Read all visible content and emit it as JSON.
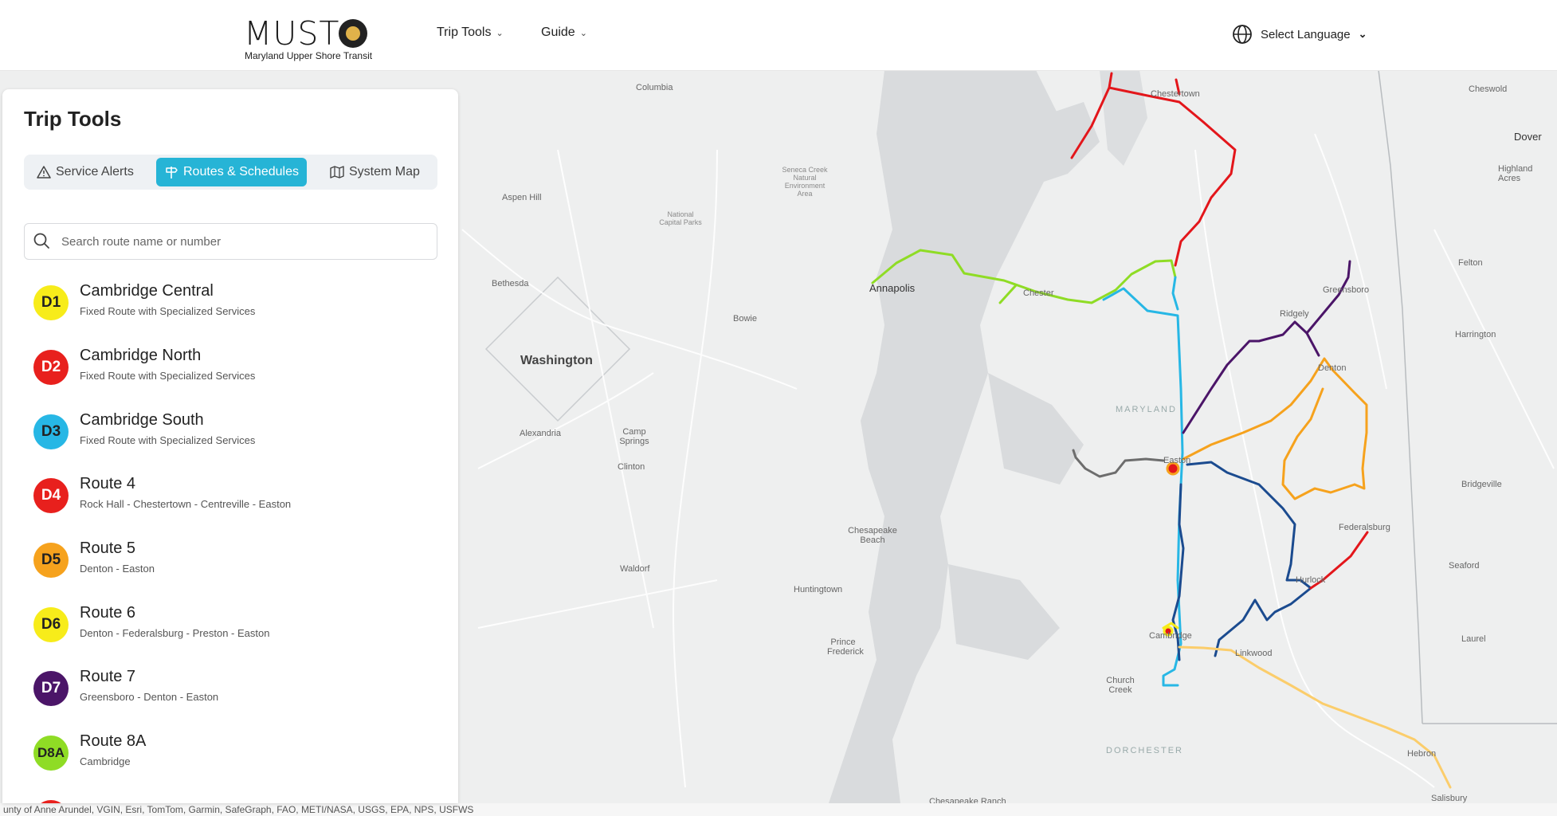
{
  "header": {
    "logo_text": "MUST",
    "logo_subtitle": "Maryland Upper Shore Transit",
    "nav": [
      {
        "label": "Trip Tools"
      },
      {
        "label": "Guide"
      }
    ],
    "language_label": "Select Language"
  },
  "panel": {
    "title": "Trip Tools",
    "tabs": [
      {
        "label": "Service Alerts",
        "icon": "alert-triangle-icon",
        "active": false
      },
      {
        "label": "Routes & Schedules",
        "icon": "signpost-icon",
        "active": true
      },
      {
        "label": "System Map",
        "icon": "map-icon",
        "active": false
      }
    ],
    "search": {
      "placeholder": "Search route name or number",
      "value": ""
    },
    "routes": [
      {
        "code": "D1",
        "name": "Cambridge Central",
        "desc": "Fixed Route with Specialized Services",
        "color": "#f7ec1a",
        "text_color": "#222222"
      },
      {
        "code": "D2",
        "name": "Cambridge North",
        "desc": "Fixed Route with Specialized Services",
        "color": "#e8201d",
        "text_color": "#ffffff"
      },
      {
        "code": "D3",
        "name": "Cambridge South",
        "desc": "Fixed Route with Specialized Services",
        "color": "#27b7e5",
        "text_color": "#222222"
      },
      {
        "code": "D4",
        "name": "Route 4",
        "desc": "Rock Hall - Chestertown - Centreville - Easton",
        "color": "#e8201d",
        "text_color": "#ffffff"
      },
      {
        "code": "D5",
        "name": "Route 5",
        "desc": "Denton - Easton",
        "color": "#f6a21d",
        "text_color": "#222222"
      },
      {
        "code": "D6",
        "name": "Route 6",
        "desc": "Denton - Federalsburg - Preston - Easton",
        "color": "#f7ec1a",
        "text_color": "#222222"
      },
      {
        "code": "D7",
        "name": "Route 7",
        "desc": "Greensboro - Denton - Easton",
        "color": "#4b1568",
        "text_color": "#ffffff"
      },
      {
        "code": "D8A",
        "name": "Route 8A",
        "desc": "Cambridge",
        "color": "#8fdc25",
        "text_color": "#222222"
      }
    ]
  },
  "map": {
    "labels": [
      {
        "text": "Columbia",
        "cls": ""
      },
      {
        "text": "Chestertown",
        "cls": ""
      },
      {
        "text": "Cheswold",
        "cls": ""
      },
      {
        "text": "Dover",
        "cls": "mid"
      },
      {
        "text": "Highland Acres",
        "cls": ""
      },
      {
        "text": "Aspen Hill",
        "cls": ""
      },
      {
        "text": "Seneca Creek Natural Environment Area",
        "cls": ""
      },
      {
        "text": "National Capital Parks",
        "cls": ""
      },
      {
        "text": "Bethesda",
        "cls": ""
      },
      {
        "text": "Annapolis",
        "cls": "mid"
      },
      {
        "text": "Chester",
        "cls": ""
      },
      {
        "text": "Bowie",
        "cls": ""
      },
      {
        "text": "Washington",
        "cls": "big"
      },
      {
        "text": "Ridgely",
        "cls": ""
      },
      {
        "text": "Greensboro",
        "cls": ""
      },
      {
        "text": "Felton",
        "cls": ""
      },
      {
        "text": "Harrington",
        "cls": ""
      },
      {
        "text": "Denton",
        "cls": ""
      },
      {
        "text": "MARYLAND",
        "cls": "region"
      },
      {
        "text": "Alexandria",
        "cls": ""
      },
      {
        "text": "Camp Springs",
        "cls": ""
      },
      {
        "text": "Clinton",
        "cls": ""
      },
      {
        "text": "Easton",
        "cls": ""
      },
      {
        "text": "Bridgeville",
        "cls": ""
      },
      {
        "text": "Chesapeake Beach",
        "cls": ""
      },
      {
        "text": "Federalsburg",
        "cls": ""
      },
      {
        "text": "Waldorf",
        "cls": ""
      },
      {
        "text": "Seaford",
        "cls": ""
      },
      {
        "text": "Hurlock",
        "cls": ""
      },
      {
        "text": "Huntingtown",
        "cls": ""
      },
      {
        "text": "Cambridge",
        "cls": ""
      },
      {
        "text": "Laurel",
        "cls": ""
      },
      {
        "text": "Prince Frederick",
        "cls": ""
      },
      {
        "text": "Linkwood",
        "cls": ""
      },
      {
        "text": "Church Creek",
        "cls": ""
      },
      {
        "text": "Hebron",
        "cls": ""
      },
      {
        "text": "DORCHESTER",
        "cls": "region"
      },
      {
        "text": "Chesapeake Ranch",
        "cls": ""
      },
      {
        "text": "Salisbury",
        "cls": ""
      }
    ],
    "attribution": "unty of Anne Arundel, VGIN, Esri, TomTom, Garmin, SafeGraph, FAO, METI/NASA, USGS, EPA, NPS, USFWS"
  }
}
